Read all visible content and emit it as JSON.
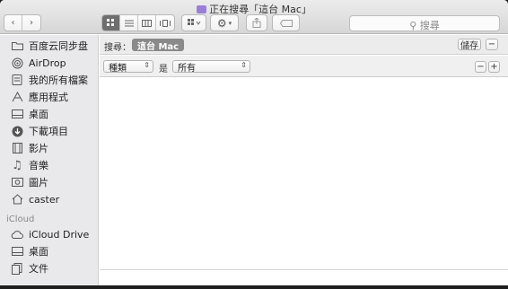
{
  "window": {
    "title": "正在搜尋「這台 Mac」"
  },
  "toolbar": {
    "back": "‹",
    "forward": "›",
    "search_placeholder": "搜尋"
  },
  "sidebar": {
    "items": [
      {
        "label": "百度云同步盘",
        "icon": "folder-icon"
      },
      {
        "label": "AirDrop",
        "icon": "airdrop-icon"
      },
      {
        "label": "我的所有檔案",
        "icon": "all-files-icon"
      },
      {
        "label": "應用程式",
        "icon": "applications-icon"
      },
      {
        "label": "桌面",
        "icon": "desktop-icon"
      },
      {
        "label": "下載項目",
        "icon": "downloads-icon"
      },
      {
        "label": "影片",
        "icon": "movies-icon"
      },
      {
        "label": "音樂",
        "icon": "music-icon"
      },
      {
        "label": "圖片",
        "icon": "pictures-icon"
      },
      {
        "label": "caster",
        "icon": "home-icon"
      }
    ],
    "icloud_header": "iCloud",
    "icloud_items": [
      {
        "label": "iCloud Drive",
        "icon": "cloud-icon"
      },
      {
        "label": "桌面",
        "icon": "desktop-icon"
      },
      {
        "label": "文件",
        "icon": "documents-icon"
      }
    ]
  },
  "scope": {
    "label": "搜尋：",
    "chip": "這台 Mac",
    "save": "儲存",
    "minus": "−"
  },
  "criteria": {
    "attribute": "種類",
    "operator": "是",
    "value": "所有",
    "minus": "−",
    "plus": "+"
  }
}
